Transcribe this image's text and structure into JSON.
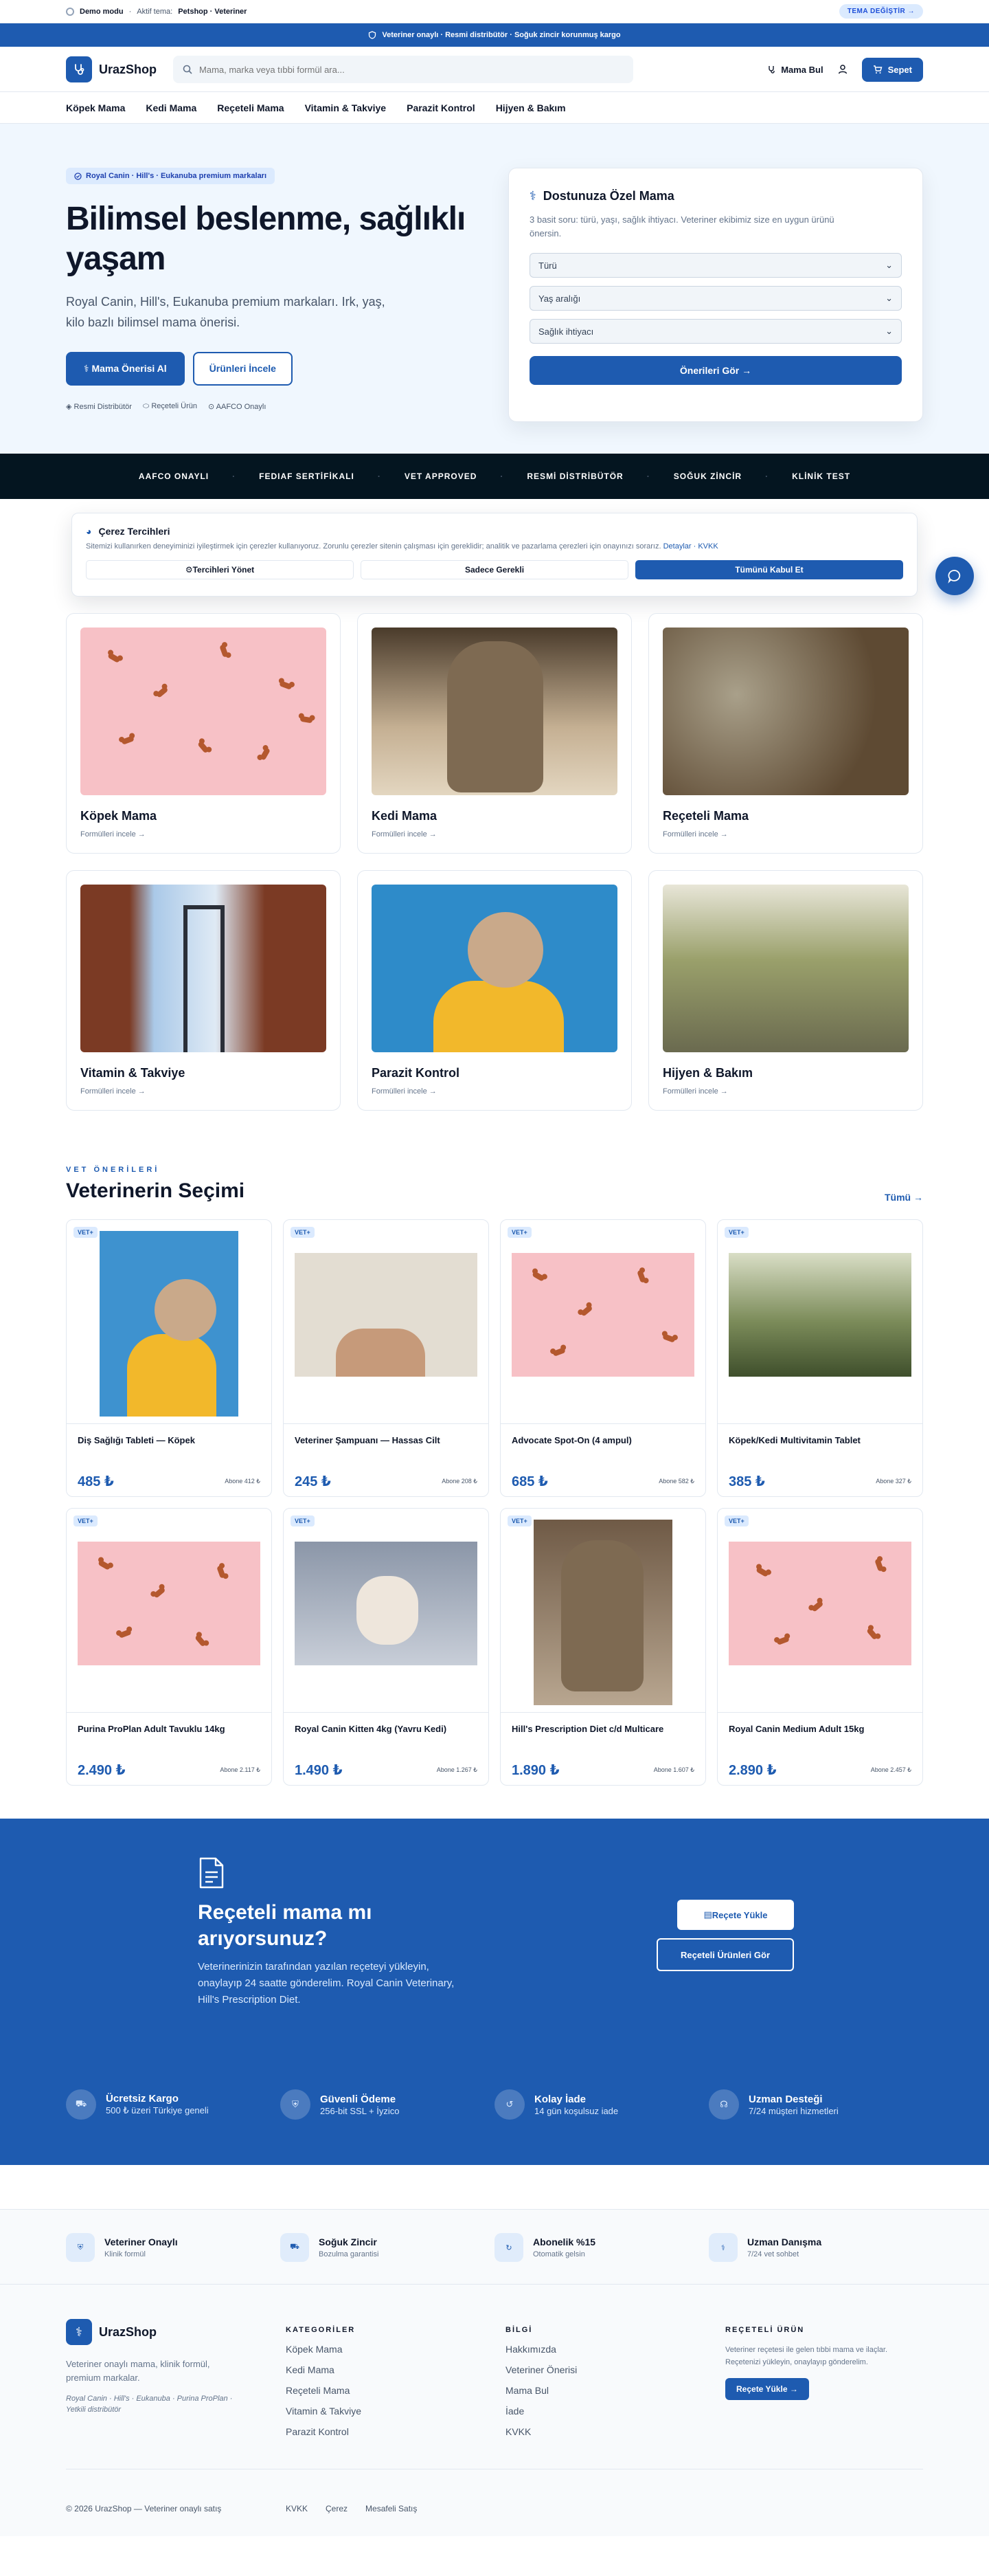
{
  "demo": {
    "mode": "Demo modu",
    "active": "Aktif tema:",
    "theme": "Petshop · Veteriner",
    "switch": "TEMA DEĞİŞTİR →"
  },
  "announce": "Veteriner onaylı · Resmi distribütör · Soğuk zincir korunmuş kargo",
  "header": {
    "logo": "UrazShop",
    "search_placeholder": "Mama, marka veya tıbbi formül ara...",
    "find": "Mama Bul",
    "cart": "Sepet"
  },
  "nav": [
    "Köpek Mama",
    "Kedi Mama",
    "Reçeteli Mama",
    "Vitamin & Takviye",
    "Parazit Kontrol",
    "Hijyen & Bakım"
  ],
  "hero": {
    "pill": "Royal Canin · Hill's · Eukanuba premium markaları",
    "title": "Bilimsel beslenme, sağlıklı yaşam",
    "desc": "Royal Canin, Hill's, Eukanuba premium markaları. Irk, yaş, kilo bazlı bilimsel mama önerisi.",
    "btn1": "Mama Önerisi Al",
    "btn2": "Ürünleri İncele",
    "badges": [
      "Resmi Distribütör",
      "Reçeteli Ürün",
      "AAFCO Onaylı"
    ]
  },
  "rec": {
    "title": "Dostunuza Özel Mama",
    "desc": "3 basit soru: türü, yaşı, sağlık ihtiyacı. Veteriner ekibimiz size en uygun ürünü önersin.",
    "selects": [
      "Türü",
      "Yaş aralığı",
      "Sağlık ihtiyacı"
    ],
    "button": "Önerileri Gör →"
  },
  "strip": [
    "AAFCO ONAYLI",
    "FEDIAF SERTİFİKALI",
    "VET APPROVED",
    "RESMİ DİSTRİBÜTÖR",
    "SOĞUK ZİNCİR",
    "KLİNİK TEST"
  ],
  "cookie": {
    "title": "Çerez Tercihleri",
    "text": "Sitemizi kullanırken deneyiminizi iyileştirmek için çerezler kullanıyoruz. Zorunlu çerezler sitenin çalışması için gereklidir; analitik ve pazarlama çerezleri için onayınızı sorarız.",
    "link": "Detaylar · KVKK",
    "btn1": "Tercihleri Yönet",
    "btn2": "Sadece Gerekli",
    "btn3": "Tümünü Kabul Et"
  },
  "categories": [
    {
      "name": "Köpek Mama",
      "link": "Formülleri incele →"
    },
    {
      "name": "Kedi Mama",
      "link": "Formülleri incele →"
    },
    {
      "name": "Reçeteli Mama",
      "link": "Formülleri incele →"
    },
    {
      "name": "Vitamin & Takviye",
      "link": "Formülleri incele →"
    },
    {
      "name": "Parazit Kontrol",
      "link": "Formülleri incele →"
    },
    {
      "name": "Hijyen & Bakım",
      "link": "Formülleri incele →"
    }
  ],
  "vet": {
    "eyebrow": "VET ÖNERİLERİ",
    "title": "Veterinerin Seçimi",
    "all": "Tümü →",
    "badge": "VET+"
  },
  "products": [
    {
      "name": "Diş Sağlığı Tableti — Köpek",
      "price": "485 ₺",
      "sub": "Abone 412 ₺"
    },
    {
      "name": "Veteriner Şampuanı — Hassas Cilt",
      "price": "245 ₺",
      "sub": "Abone 208 ₺"
    },
    {
      "name": "Advocate Spot-On (4 ampul)",
      "price": "685 ₺",
      "sub": "Abone 582 ₺"
    },
    {
      "name": "Köpek/Kedi Multivitamin Tablet",
      "price": "385 ₺",
      "sub": "Abone 327 ₺"
    },
    {
      "name": "Purina ProPlan Adult Tavuklu 14kg",
      "price": "2.490 ₺",
      "sub": "Abone 2.117 ₺"
    },
    {
      "name": "Royal Canin Kitten 4kg (Yavru Kedi)",
      "price": "1.490 ₺",
      "sub": "Abone 1.267 ₺"
    },
    {
      "name": "Hill's Prescription Diet c/d Multicare",
      "price": "1.890 ₺",
      "sub": "Abone 1.607 ₺"
    },
    {
      "name": "Royal Canin Medium Adult 15kg",
      "price": "2.890 ₺",
      "sub": "Abone 2.457 ₺"
    }
  ],
  "rx": {
    "title": "Reçeteli mama mı arıyorsunuz?",
    "desc": "Veterinerinizin tarafından yazılan reçeteyi yükleyin, onaylayıp 24 saatte gönderelim. Royal Canin Veterinary, Hill's Prescription Diet.",
    "btn1": "Reçete Yükle",
    "btn2": "Reçeteli Ürünleri Gör"
  },
  "features": [
    {
      "title": "Ücretsiz Kargo",
      "sub": "500 ₺ üzeri Türkiye geneli"
    },
    {
      "title": "Güvenli Ödeme",
      "sub": "256-bit SSL + İyzico"
    },
    {
      "title": "Kolay İade",
      "sub": "14 gün koşulsuz iade"
    },
    {
      "title": "Uzman Desteği",
      "sub": "7/24 müşteri hizmetleri"
    }
  ],
  "trust": [
    {
      "title": "Veteriner Onaylı",
      "sub": "Klinik formül"
    },
    {
      "title": "Soğuk Zincir",
      "sub": "Bozulma garantisi"
    },
    {
      "title": "Abonelik %15",
      "sub": "Otomatik gelsin"
    },
    {
      "title": "Uzman Danışma",
      "sub": "7/24 vet sohbet"
    }
  ],
  "footer": {
    "logo": "UrazShop",
    "desc": "Veteriner onaylı mama, klinik formül, premium markalar.",
    "brands": "Royal Canin · Hill's · Eukanuba · Purina ProPlan · Yetkili distribütör",
    "col1_title": "KATEGORİLER",
    "col1": [
      "Köpek Mama",
      "Kedi Mama",
      "Reçeteli Mama",
      "Vitamin & Takviye",
      "Parazit Kontrol"
    ],
    "col2_title": "BİLGİ",
    "col2": [
      "Hakkımızda",
      "Veteriner Önerisi",
      "Mama Bul",
      "İade",
      "KVKK"
    ],
    "col3_title": "REÇETELİ ÜRÜN",
    "col3_text": "Veteriner reçetesi ile gelen tıbbi mama ve ilaçlar. Reçetenizi yükleyin, onaylayıp gönderelim.",
    "col3_btn": "Reçete Yükle →",
    "copy": "© 2026 UrazShop — Veteriner onaylı satış",
    "links": [
      "KVKK",
      "Çerez",
      "Mesafeli Satış"
    ]
  }
}
